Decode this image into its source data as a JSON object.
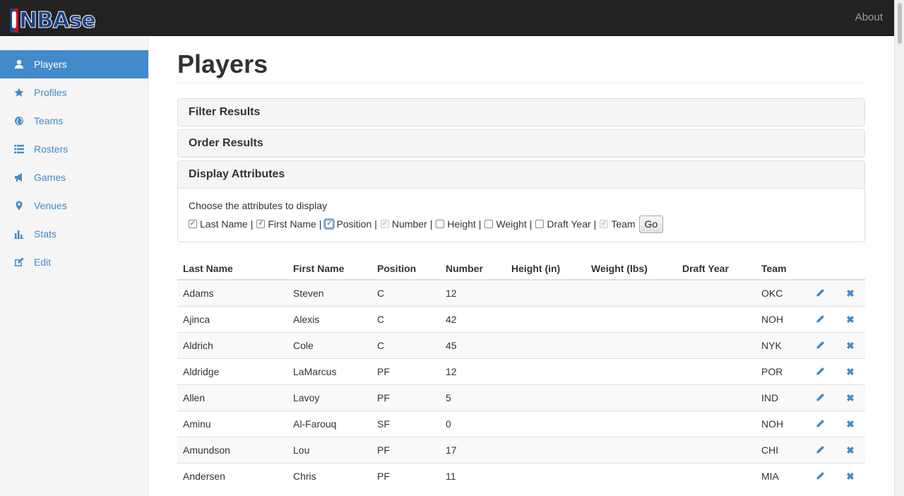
{
  "navbar": {
    "brand": "NBAse",
    "about_label": "About"
  },
  "sidebar": {
    "items": [
      {
        "label": "Players",
        "icon": "user-icon"
      },
      {
        "label": "Profiles",
        "icon": "star-icon"
      },
      {
        "label": "Teams",
        "icon": "globe-icon"
      },
      {
        "label": "Rosters",
        "icon": "list-icon"
      },
      {
        "label": "Games",
        "icon": "bullhorn-icon"
      },
      {
        "label": "Venues",
        "icon": "map-marker-icon"
      },
      {
        "label": "Stats",
        "icon": "stats-icon"
      },
      {
        "label": "Edit",
        "icon": "edit-icon"
      }
    ],
    "active_color": "#428bca"
  },
  "page": {
    "title": "Players"
  },
  "panels": {
    "filter": "Filter Results",
    "order": "Order Results",
    "display": "Display Attributes"
  },
  "display_attributes": {
    "prompt": "Choose the attributes to display",
    "options": [
      {
        "label": "Last Name",
        "state": "checked"
      },
      {
        "label": "First Name",
        "state": "checked"
      },
      {
        "label": "Position",
        "state": "checked"
      },
      {
        "label": "Number",
        "state": "disabled-checked"
      },
      {
        "label": "Height",
        "state": "unchecked"
      },
      {
        "label": "Weight",
        "state": "unchecked"
      },
      {
        "label": "Draft Year",
        "state": "unchecked"
      },
      {
        "label": "Team",
        "state": "disabled-checked"
      }
    ],
    "go_label": "Go"
  },
  "table": {
    "headers": [
      "Last Name",
      "First Name",
      "Position",
      "Number",
      "Height (in)",
      "Weight (lbs)",
      "Draft Year",
      "Team"
    ],
    "rows": [
      [
        "Adams",
        "Steven",
        "C",
        "12",
        "",
        "",
        "",
        "OKC"
      ],
      [
        "Ajinca",
        "Alexis",
        "C",
        "42",
        "",
        "",
        "",
        "NOH"
      ],
      [
        "Aldrich",
        "Cole",
        "C",
        "45",
        "",
        "",
        "",
        "NYK"
      ],
      [
        "Aldridge",
        "LaMarcus",
        "PF",
        "12",
        "",
        "",
        "",
        "POR"
      ],
      [
        "Allen",
        "Lavoy",
        "PF",
        "5",
        "",
        "",
        "",
        "IND"
      ],
      [
        "Aminu",
        "Al-Farouq",
        "SF",
        "0",
        "",
        "",
        "",
        "NOH"
      ],
      [
        "Amundson",
        "Lou",
        "PF",
        "17",
        "",
        "",
        "",
        "CHI"
      ],
      [
        "Andersen",
        "Chris",
        "PF",
        "11",
        "",
        "",
        "",
        "MIA"
      ]
    ],
    "row_actions": [
      "pencil-icon",
      "remove-icon"
    ]
  }
}
